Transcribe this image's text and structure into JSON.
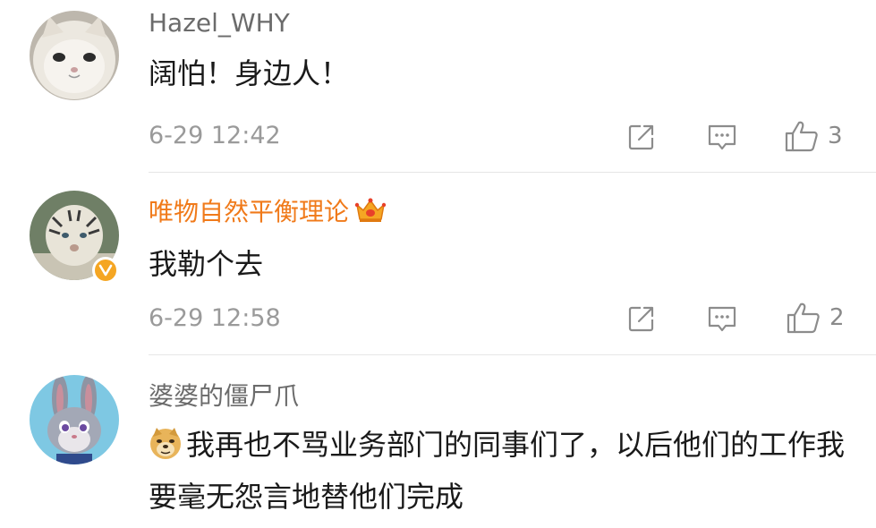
{
  "comments": [
    {
      "username": "Hazel_WHY",
      "text": "阔怕！身边人！",
      "time": "6-29 12:42",
      "likes": "3"
    },
    {
      "username": "唯物自然平衡理论",
      "text": "我勒个去",
      "time": "6-29 12:58",
      "likes": "2"
    },
    {
      "username": "婆婆的僵尸爪",
      "text": "我再也不骂业务部门的同事们了，以后他们的工作我要毫无怨言地替他们完成"
    }
  ],
  "icons": {
    "share": "share-icon",
    "reply": "comment-icon",
    "like": "thumbs-up-icon",
    "vip": "crown-icon",
    "verified": "verified-badge-icon",
    "emoji": "doge-emoji-icon"
  },
  "colors": {
    "vip_name": "#f07a1a",
    "username": "#6b6b6b",
    "meta": "#9a9a9a",
    "divider": "#e6e6e6",
    "verified_badge": "#f5a623"
  }
}
